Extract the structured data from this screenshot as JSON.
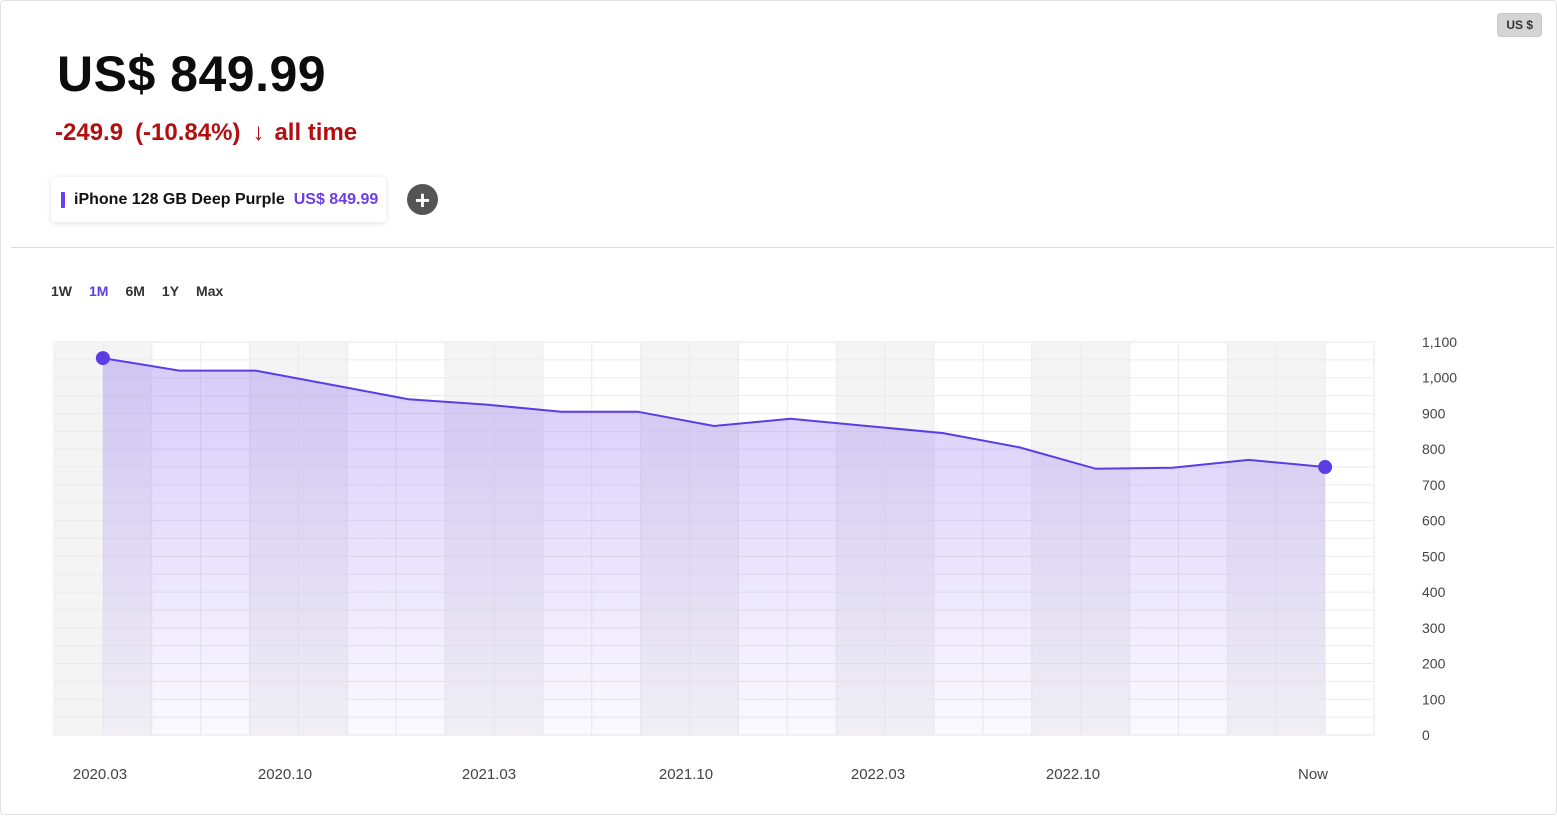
{
  "currency_button": "US $",
  "price": "US$ 849.99",
  "change": {
    "amount": "-249.9",
    "percent": "(-10.84%)",
    "arrow_icon": "arrow-down-icon",
    "period": "all time",
    "color": "#b30f10"
  },
  "product": {
    "name": "iPhone 128 GB Deep Purple",
    "price": "US$ 849.99",
    "accent": "#6a3ee8"
  },
  "add_button_icon": "plus-icon",
  "ranges": [
    "1W",
    "1M",
    "6M",
    "1Y",
    "Max"
  ],
  "active_range": "1M",
  "chart_data": {
    "type": "area",
    "x_labels": [
      "2020.03",
      "2020.10",
      "2021.03",
      "2021.10",
      "2022.03",
      "2022.10",
      "Now"
    ],
    "y_ticks": [
      0,
      100,
      200,
      300,
      400,
      500,
      600,
      700,
      800,
      900,
      "1,000",
      "1,100"
    ],
    "ylim": [
      0,
      1100
    ],
    "series": [
      {
        "color": "#5b3de8",
        "values": [
          1055,
          1020,
          1020,
          980,
          940,
          925,
          905,
          905,
          865,
          885,
          865,
          845,
          805,
          745,
          748,
          770,
          750
        ]
      }
    ],
    "grid": true
  }
}
